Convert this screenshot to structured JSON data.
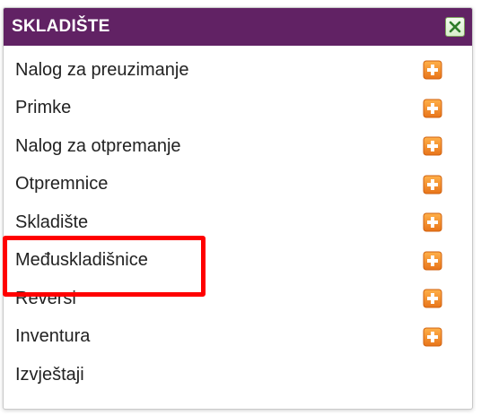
{
  "panel": {
    "title": "SKLADIŠTE",
    "close_icon": "close-x-icon",
    "add_icon": "plus-square-icon",
    "accent_color": "#612264",
    "add_icon_color": "#f28a1e",
    "highlight_color": "#ff0000",
    "highlighted_item": "Međuskladišnice"
  },
  "items": [
    {
      "label": "Nalog za preuzimanje",
      "has_add": true
    },
    {
      "label": "Primke",
      "has_add": true
    },
    {
      "label": "Nalog za otpremanje",
      "has_add": true
    },
    {
      "label": "Otpremnice",
      "has_add": true
    },
    {
      "label": "Skladište",
      "has_add": true
    },
    {
      "label": "Međuskladišnice",
      "has_add": true
    },
    {
      "label": "Reversi",
      "has_add": true
    },
    {
      "label": "Inventura",
      "has_add": true
    },
    {
      "label": "Izvještaji",
      "has_add": false
    }
  ]
}
